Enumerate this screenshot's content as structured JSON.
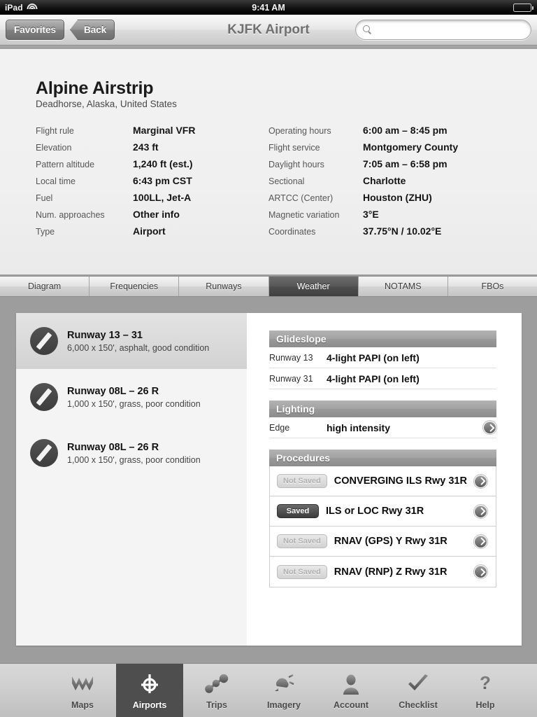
{
  "status_bar": {
    "device": "iPad",
    "wifi_icon": "wifi-icon",
    "time": "9:41 AM",
    "battery_icon": "battery-icon"
  },
  "navbar": {
    "favorites_label": "Favorites",
    "back_label": "Back",
    "title": "KJFK Airport",
    "search_placeholder": "",
    "search_value": "",
    "search_icon": "search-icon"
  },
  "airport": {
    "name": "Alpine Airstrip",
    "location": "Deadhorse, Alaska, United States",
    "left_fields": [
      {
        "label": "Flight rule",
        "value": "Marginal VFR"
      },
      {
        "label": "Elevation",
        "value": "243 ft"
      },
      {
        "label": "Pattern altitude",
        "value": "1,240 ft (est.)"
      },
      {
        "label": "Local time",
        "value": "6:43 pm CST"
      },
      {
        "label": "Fuel",
        "value": "100LL, Jet-A"
      },
      {
        "label": "Num. approaches",
        "value": "Other info"
      },
      {
        "label": "Type",
        "value": "Airport"
      }
    ],
    "right_fields": [
      {
        "label": "Operating hours",
        "value": "6:00 am – 8:45 pm"
      },
      {
        "label": "Flight service",
        "value": "Montgomery County"
      },
      {
        "label": "Daylight hours",
        "value": "7:05 am – 6:58 pm"
      },
      {
        "label": "Sectional",
        "value": "Charlotte"
      },
      {
        "label": "ARTCC (Center)",
        "value": "Houston (ZHU)"
      },
      {
        "label": "Magnetic variation",
        "value": "3°E"
      },
      {
        "label": "Coordinates",
        "value": "37.75°N / 10.02°E"
      }
    ]
  },
  "tabs": [
    {
      "label": "Diagram",
      "active": false
    },
    {
      "label": "Frequencies",
      "active": false
    },
    {
      "label": "Runways",
      "active": false
    },
    {
      "label": "Weather",
      "active": true
    },
    {
      "label": "NOTAMS",
      "active": false
    },
    {
      "label": "FBOs",
      "active": false
    }
  ],
  "runways": [
    {
      "title": "Runway 13 – 31",
      "subtitle": "6,000 x 150', asphalt, good condition",
      "selected": true,
      "icon": "runway-icon"
    },
    {
      "title": "Runway 08L – 26 R",
      "subtitle": "1,000 x 150', grass, poor condition",
      "selected": false,
      "icon": "runway-icon"
    },
    {
      "title": "Runway 08L – 26 R",
      "subtitle": "1,000 x 150', grass, poor condition",
      "selected": false,
      "icon": "runway-icon"
    }
  ],
  "detail": {
    "glideslope": {
      "header": "Glideslope",
      "rows": [
        {
          "label": "Runway 13",
          "value": "4-light PAPI (on left)"
        },
        {
          "label": "Runway 31",
          "value": "4-light PAPI (on left)"
        }
      ]
    },
    "lighting": {
      "header": "Lighting",
      "rows": [
        {
          "label": "Edge",
          "value": "high intensity",
          "disclosure": true
        }
      ]
    },
    "procedures": {
      "header": "Procedures",
      "rows": [
        {
          "badge": "Not Saved",
          "saved": false,
          "name": "CONVERGING ILS Rwy 31R"
        },
        {
          "badge": "Saved",
          "saved": true,
          "name": "ILS or LOC Rwy 31R"
        },
        {
          "badge": "Not Saved",
          "saved": false,
          "name": "RNAV (GPS) Y Rwy 31R"
        },
        {
          "badge": "Not Saved",
          "saved": false,
          "name": "RNAV (RNP) Z Rwy 31R"
        }
      ]
    }
  },
  "toolbar": [
    {
      "label": "Maps",
      "icon": "maps-icon",
      "active": false
    },
    {
      "label": "Airports",
      "icon": "airports-icon",
      "active": true
    },
    {
      "label": "Trips",
      "icon": "trips-icon",
      "active": false
    },
    {
      "label": "Imagery",
      "icon": "imagery-icon",
      "active": false
    },
    {
      "label": "Account",
      "icon": "account-icon",
      "active": false
    },
    {
      "label": "Checklist",
      "icon": "checklist-icon",
      "active": false
    },
    {
      "label": "Help",
      "icon": "help-icon",
      "active": false
    }
  ],
  "colors": {
    "background": "#9d9d9d",
    "panel": "#ffffff",
    "accent_active": "#4e4e4e",
    "info_panel": "#f0f0f0"
  }
}
